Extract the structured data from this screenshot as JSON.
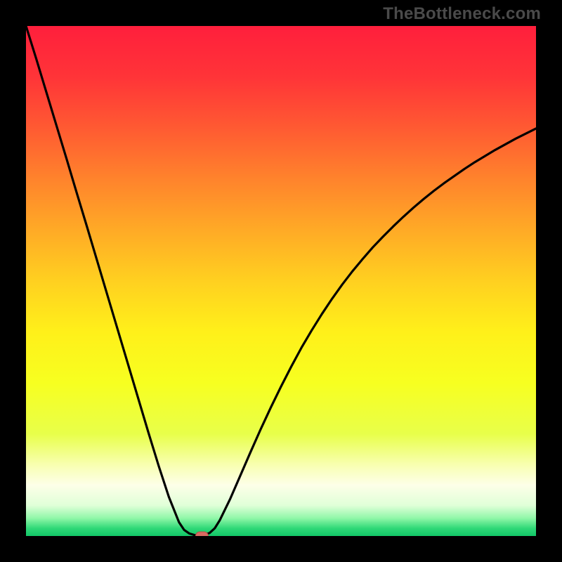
{
  "watermark": {
    "text": "TheBottleneck.com"
  },
  "chart_data": {
    "type": "line",
    "title": "",
    "xlabel": "",
    "ylabel": "",
    "xlim": [
      0,
      100
    ],
    "ylim": [
      0,
      100
    ],
    "x": [
      0,
      2,
      4,
      6,
      8,
      10,
      12,
      14,
      16,
      18,
      20,
      22,
      24,
      26,
      28,
      30,
      31,
      32,
      33,
      34,
      35,
      36,
      37,
      38,
      40,
      42,
      44,
      46,
      48,
      50,
      52,
      54,
      56,
      58,
      60,
      62,
      64,
      66,
      68,
      70,
      72,
      74,
      76,
      78,
      80,
      82,
      84,
      86,
      88,
      90,
      92,
      94,
      96,
      98,
      100
    ],
    "y": [
      100,
      93.6,
      87.0,
      80.4,
      73.8,
      67.1,
      60.5,
      53.8,
      47.1,
      40.4,
      33.7,
      27.0,
      20.3,
      13.8,
      7.7,
      2.7,
      1.2,
      0.5,
      0.2,
      0.1,
      0.2,
      0.6,
      1.5,
      3.1,
      7.2,
      11.8,
      16.4,
      20.9,
      25.2,
      29.3,
      33.2,
      36.9,
      40.3,
      43.5,
      46.5,
      49.3,
      51.9,
      54.3,
      56.6,
      58.7,
      60.7,
      62.6,
      64.4,
      66.1,
      67.7,
      69.2,
      70.6,
      72.0,
      73.3,
      74.5,
      75.7,
      76.8,
      77.9,
      78.9,
      79.9
    ],
    "marker": {
      "x": 34.5,
      "y": 0.0
    },
    "gradient_stops": [
      {
        "offset": 0.0,
        "color": "#ff1f3c"
      },
      {
        "offset": 0.1,
        "color": "#ff3438"
      },
      {
        "offset": 0.2,
        "color": "#ff5a32"
      },
      {
        "offset": 0.3,
        "color": "#ff832c"
      },
      {
        "offset": 0.4,
        "color": "#ffaa26"
      },
      {
        "offset": 0.5,
        "color": "#ffd020"
      },
      {
        "offset": 0.6,
        "color": "#fff01a"
      },
      {
        "offset": 0.7,
        "color": "#f7ff20"
      },
      {
        "offset": 0.8,
        "color": "#e8ff4a"
      },
      {
        "offset": 0.86,
        "color": "#f8ffb0"
      },
      {
        "offset": 0.9,
        "color": "#fdffe8"
      },
      {
        "offset": 0.94,
        "color": "#e0ffd8"
      },
      {
        "offset": 0.965,
        "color": "#90f7a8"
      },
      {
        "offset": 0.985,
        "color": "#2fd877"
      },
      {
        "offset": 1.0,
        "color": "#12c768"
      }
    ],
    "line_style": {
      "stroke": "#000000",
      "width": 3.2
    },
    "marker_style": {
      "fill": "#d86b62",
      "stroke": "#b24f47",
      "width": 18,
      "height": 12,
      "rx": 6
    }
  }
}
